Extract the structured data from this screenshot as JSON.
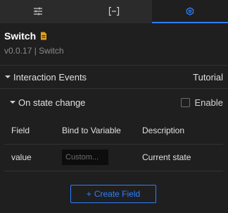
{
  "tabs": [
    {
      "name": "sliders-icon",
      "active": false
    },
    {
      "name": "bracket-icon",
      "active": false
    },
    {
      "name": "interaction-icon",
      "active": true
    }
  ],
  "header": {
    "title": "Switch",
    "subtitle": "v0.0.17 | Switch"
  },
  "interaction_events": {
    "label": "Interaction Events",
    "tutorial": "Tutorial"
  },
  "state_change": {
    "label": "On state change",
    "enable_label": "Enable",
    "enabled": false
  },
  "table": {
    "headers": [
      "Field",
      "Bind to Variable",
      "Description"
    ],
    "rows": [
      {
        "field": "value",
        "placeholder": "Custom...",
        "description": "Current state"
      }
    ]
  },
  "create_field": {
    "plus": "+",
    "label": "Create Field"
  },
  "colors": {
    "accent": "#2f7fff",
    "background": "#1f1f1f"
  }
}
